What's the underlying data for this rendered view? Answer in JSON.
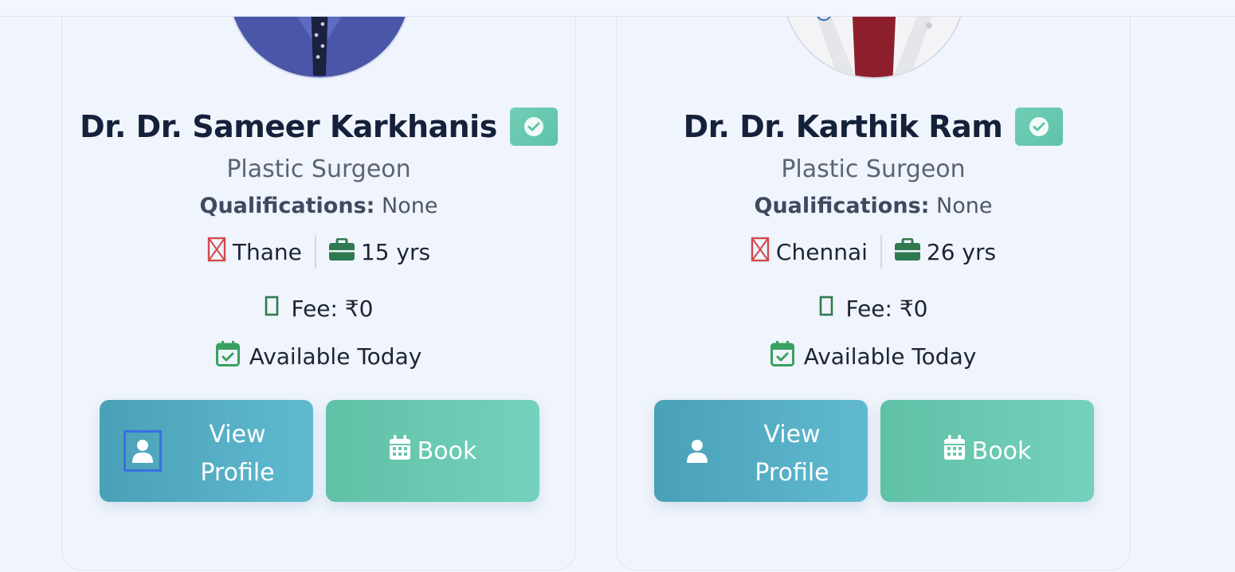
{
  "doctors": [
    {
      "name": "Dr. Dr. Sameer Karkhanis",
      "specialty": "Plastic Surgeon",
      "qualifications_label": "Qualifications:",
      "qualifications_value": "None",
      "location": "Thane",
      "experience": "15 yrs",
      "fee": "Fee: ₹0",
      "availability": "Available Today",
      "view_line1": "View",
      "view_line2": "Profile",
      "book_label": "Book"
    },
    {
      "name": "Dr. Dr. Karthik Ram",
      "specialty": "Plastic Surgeon",
      "qualifications_label": "Qualifications:",
      "qualifications_value": "None",
      "location": "Chennai",
      "experience": "26 yrs",
      "fee": "Fee: ₹0",
      "availability": "Available Today",
      "view_line1": "View",
      "view_line2": "Profile",
      "book_label": "Book"
    }
  ],
  "icons": {
    "verified": "verified-check-icon",
    "location": "map-marker-missing-glyph",
    "experience": "briefcase-icon",
    "fee": "money-missing-glyph",
    "availability": "calendar-check-icon",
    "view": "user-icon",
    "book": "calendar-icon"
  },
  "colors": {
    "teal_button": "#4aa0b7",
    "green_button": "#5fc1a6",
    "icon_green": "#2f7a4f",
    "icon_red": "#d24a4a",
    "focus_ring": "#3a6fe0"
  }
}
